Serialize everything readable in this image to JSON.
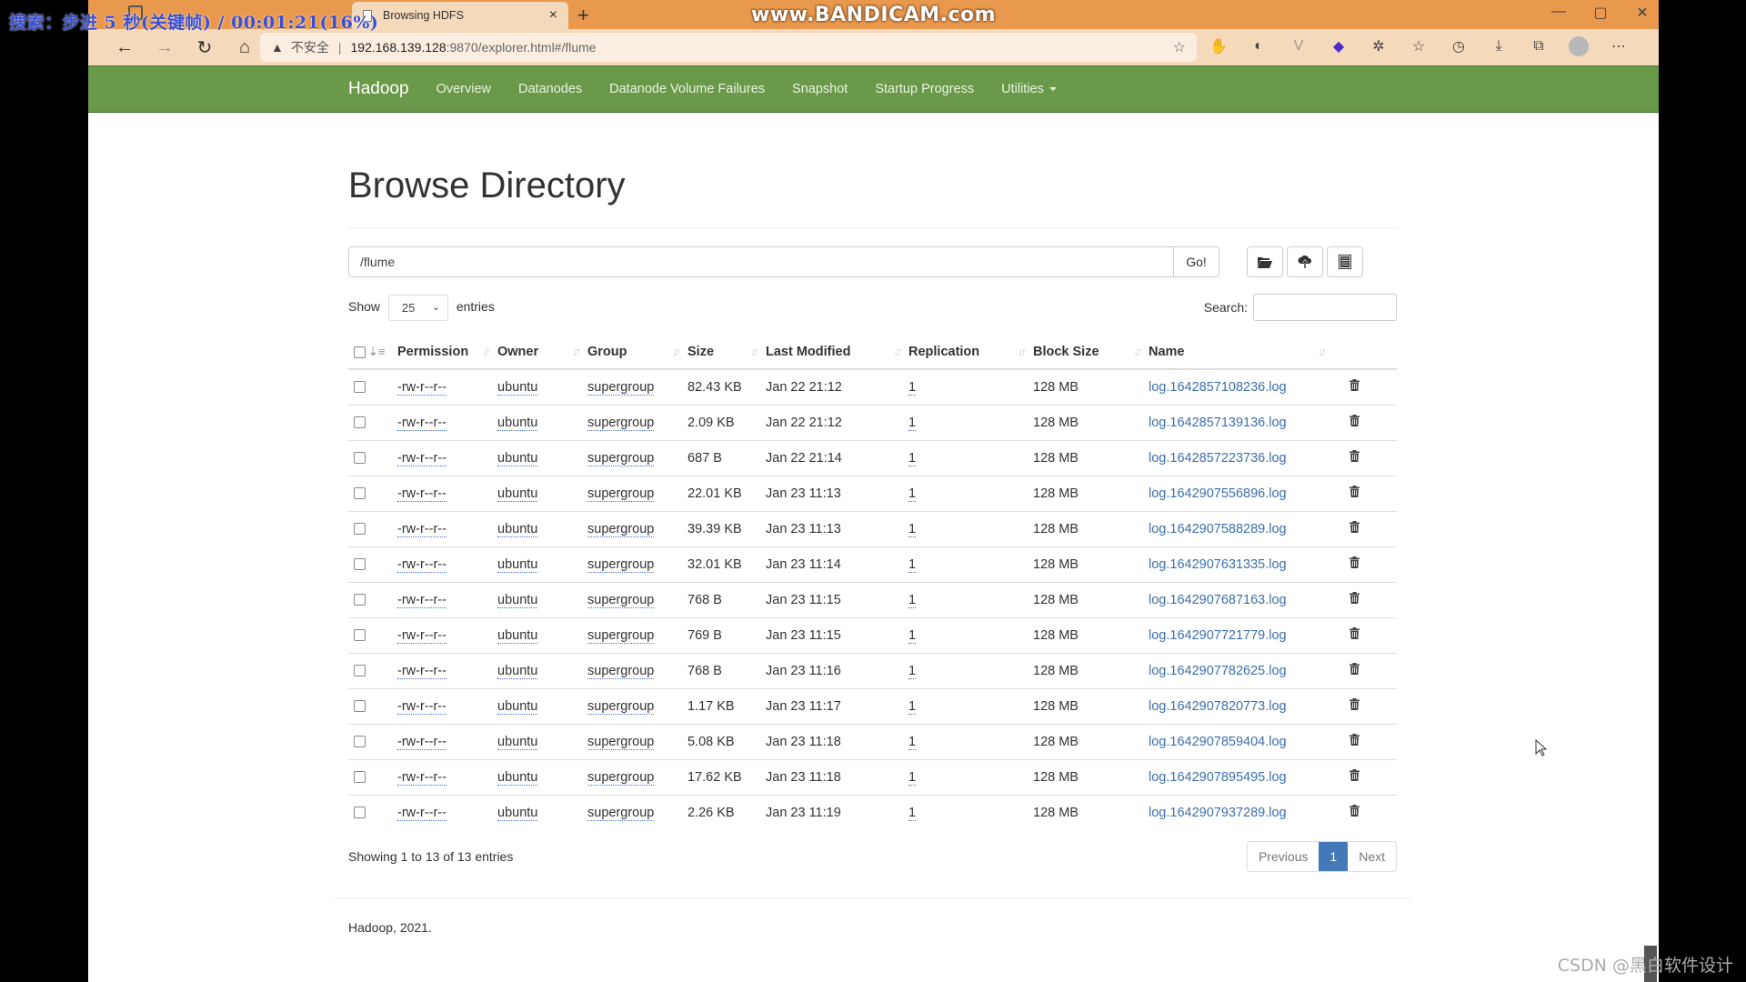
{
  "overlays": {
    "recorder_caption": "搜索：步进 5 秒(关键帧) / 00:01:21(16%)",
    "recorder_brand": "www.BANDICAM.com",
    "watermark": "CSDN @黑白软件设计"
  },
  "browser": {
    "tab_title": "Browsing HDFS",
    "tab_close": "×",
    "new_tab": "+",
    "window_controls": [
      "—",
      "▢",
      "✕"
    ],
    "address": {
      "security_label": "不安全",
      "separator": "|",
      "host": "192.168.139.128",
      "path": ":9870/explorer.html#/flume"
    }
  },
  "navbar": {
    "brand": "Hadoop",
    "links": [
      "Overview",
      "Datanodes",
      "Datanode Volume Failures",
      "Snapshot",
      "Startup Progress",
      "Utilities"
    ]
  },
  "page": {
    "title": "Browse Directory",
    "path_value": "/flume",
    "go_label": "Go!",
    "show_label": "Show",
    "entries_per_page": "25",
    "entries_label": "entries",
    "search_label": "Search:",
    "search_value": ""
  },
  "table": {
    "columns": [
      "Permission",
      "Owner",
      "Group",
      "Size",
      "Last Modified",
      "Replication",
      "Block Size",
      "Name"
    ],
    "rows": [
      {
        "permission": "-rw-r--r--",
        "owner": "ubuntu",
        "group": "supergroup",
        "size": "82.43 KB",
        "modified": "Jan 22 21:12",
        "replication": "1",
        "block_size": "128 MB",
        "name": "log.1642857108236.log"
      },
      {
        "permission": "-rw-r--r--",
        "owner": "ubuntu",
        "group": "supergroup",
        "size": "2.09 KB",
        "modified": "Jan 22 21:12",
        "replication": "1",
        "block_size": "128 MB",
        "name": "log.1642857139136.log"
      },
      {
        "permission": "-rw-r--r--",
        "owner": "ubuntu",
        "group": "supergroup",
        "size": "687 B",
        "modified": "Jan 22 21:14",
        "replication": "1",
        "block_size": "128 MB",
        "name": "log.1642857223736.log"
      },
      {
        "permission": "-rw-r--r--",
        "owner": "ubuntu",
        "group": "supergroup",
        "size": "22.01 KB",
        "modified": "Jan 23 11:13",
        "replication": "1",
        "block_size": "128 MB",
        "name": "log.1642907556896.log"
      },
      {
        "permission": "-rw-r--r--",
        "owner": "ubuntu",
        "group": "supergroup",
        "size": "39.39 KB",
        "modified": "Jan 23 11:13",
        "replication": "1",
        "block_size": "128 MB",
        "name": "log.1642907588289.log"
      },
      {
        "permission": "-rw-r--r--",
        "owner": "ubuntu",
        "group": "supergroup",
        "size": "32.01 KB",
        "modified": "Jan 23 11:14",
        "replication": "1",
        "block_size": "128 MB",
        "name": "log.1642907631335.log"
      },
      {
        "permission": "-rw-r--r--",
        "owner": "ubuntu",
        "group": "supergroup",
        "size": "768 B",
        "modified": "Jan 23 11:15",
        "replication": "1",
        "block_size": "128 MB",
        "name": "log.1642907687163.log"
      },
      {
        "permission": "-rw-r--r--",
        "owner": "ubuntu",
        "group": "supergroup",
        "size": "769 B",
        "modified": "Jan 23 11:15",
        "replication": "1",
        "block_size": "128 MB",
        "name": "log.1642907721779.log"
      },
      {
        "permission": "-rw-r--r--",
        "owner": "ubuntu",
        "group": "supergroup",
        "size": "768 B",
        "modified": "Jan 23 11:16",
        "replication": "1",
        "block_size": "128 MB",
        "name": "log.1642907782625.log"
      },
      {
        "permission": "-rw-r--r--",
        "owner": "ubuntu",
        "group": "supergroup",
        "size": "1.17 KB",
        "modified": "Jan 23 11:17",
        "replication": "1",
        "block_size": "128 MB",
        "name": "log.1642907820773.log"
      },
      {
        "permission": "-rw-r--r--",
        "owner": "ubuntu",
        "group": "supergroup",
        "size": "5.08 KB",
        "modified": "Jan 23 11:18",
        "replication": "1",
        "block_size": "128 MB",
        "name": "log.1642907859404.log"
      },
      {
        "permission": "-rw-r--r--",
        "owner": "ubuntu",
        "group": "supergroup",
        "size": "17.62 KB",
        "modified": "Jan 23 11:18",
        "replication": "1",
        "block_size": "128 MB",
        "name": "log.1642907895495.log"
      },
      {
        "permission": "-rw-r--r--",
        "owner": "ubuntu",
        "group": "supergroup",
        "size": "2.26 KB",
        "modified": "Jan 23 11:19",
        "replication": "1",
        "block_size": "128 MB",
        "name": "log.1642907937289.log"
      }
    ]
  },
  "pagination": {
    "info": "Showing 1 to 13 of 13 entries",
    "previous": "Previous",
    "current_page": "1",
    "next": "Next"
  },
  "footer": {
    "text": "Hadoop, 2021."
  },
  "colors": {
    "navbar": "#6a994a",
    "link": "#3d6fad",
    "active_page": "#4479b8",
    "browser_chrome": "#e9994e"
  }
}
